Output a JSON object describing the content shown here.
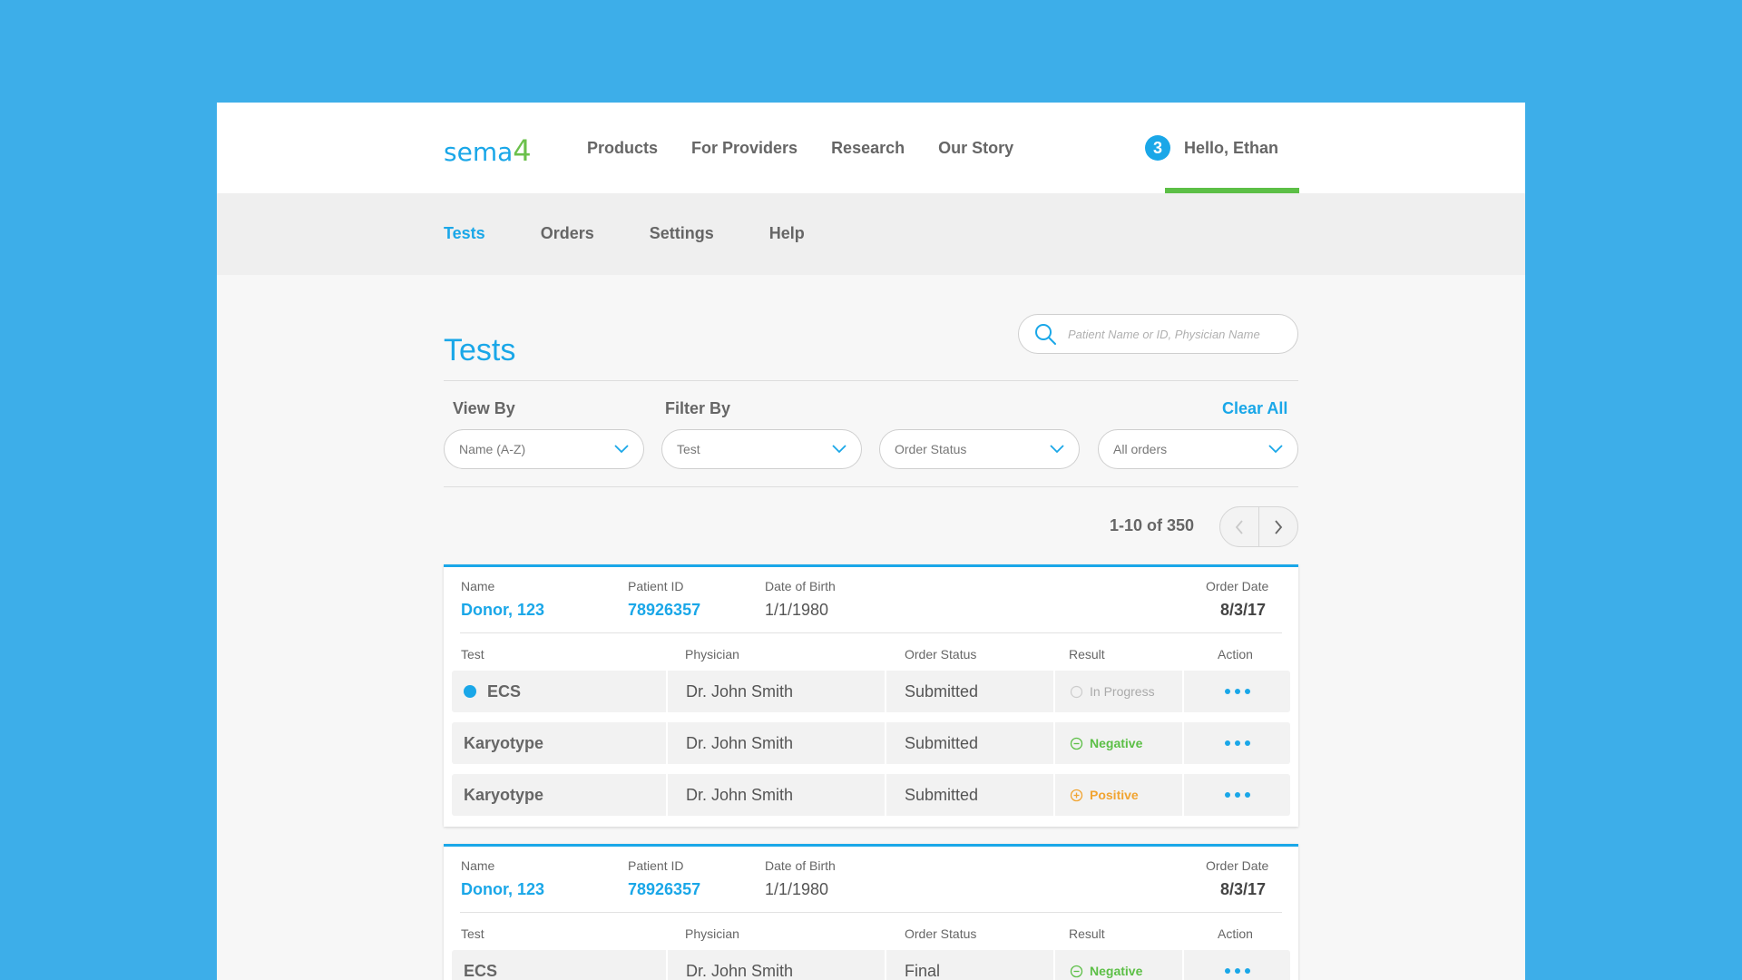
{
  "brand": {
    "logo_text": "sema",
    "logo_digit": "4",
    "logo_accent": "#6bc04b",
    "primary": "#1aa7e8"
  },
  "mainnav": [
    "Products",
    "For Providers",
    "Research",
    "Our Story"
  ],
  "user": {
    "badge": "3",
    "greeting": "Hello, Ethan"
  },
  "subnav": [
    "Tests",
    "Orders",
    "Settings",
    "Help"
  ],
  "page": {
    "title": "Tests"
  },
  "search": {
    "placeholder": "Patient Name or ID, Physician Name",
    "icon": "search-icon"
  },
  "filters": {
    "view_by_label": "View By",
    "filter_by_label": "Filter By",
    "clear_all": "Clear All",
    "dropdowns": [
      "Name (A-Z)",
      "Test",
      "Order Status",
      "All orders"
    ]
  },
  "pagination": {
    "text": "1-10 of 350"
  },
  "columns": {
    "name": "Name",
    "patient_id": "Patient ID",
    "dob": "Date of Birth",
    "order_date": "Order Date",
    "test": "Test",
    "physician": "Physician",
    "order_status": "Order Status",
    "result": "Result",
    "action": "Action"
  },
  "cards": [
    {
      "name": "Donor, 123",
      "patient_id": "78926357",
      "dob": "1/1/1980",
      "order_date": "8/3/17",
      "rows": [
        {
          "test": "ECS",
          "physician": "Dr. John Smith",
          "status": "Submitted",
          "result": "In Progress",
          "result_type": "progress",
          "indicator": "blue-dot"
        },
        {
          "test": "Karyotype",
          "physician": "Dr. John Smith",
          "status": "Submitted",
          "result": "Negative",
          "result_type": "negative"
        },
        {
          "test": "Karyotype",
          "physician": "Dr. John Smith",
          "status": "Submitted",
          "result": "Positive",
          "result_type": "positive"
        }
      ]
    },
    {
      "name": "Donor, 123",
      "patient_id": "78926357",
      "dob": "1/1/1980",
      "order_date": "8/3/17",
      "rows": [
        {
          "test": "ECS",
          "physician": "Dr. John Smith",
          "status": "Final",
          "result": "Negative",
          "result_type": "negative"
        }
      ]
    }
  ]
}
